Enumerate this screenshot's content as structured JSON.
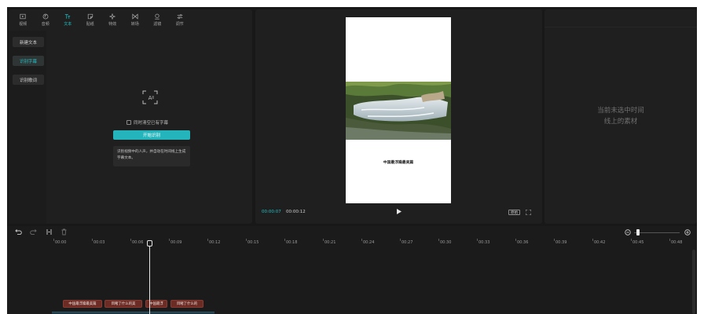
{
  "tabs": [
    {
      "label": "视频",
      "icon": "video-icon"
    },
    {
      "label": "音频",
      "icon": "audio-icon"
    },
    {
      "label": "文本",
      "icon": "text-icon",
      "active": true
    },
    {
      "label": "贴纸",
      "icon": "sticker-icon"
    },
    {
      "label": "特效",
      "icon": "effects-icon"
    },
    {
      "label": "转场",
      "icon": "transition-icon"
    },
    {
      "label": "滤镜",
      "icon": "filter-icon"
    },
    {
      "label": "调节",
      "icon": "adjust-icon"
    }
  ],
  "sidebar": {
    "items": [
      {
        "label": "新建文本"
      },
      {
        "label": "识别字幕",
        "active": true
      },
      {
        "label": "识别歌词"
      }
    ]
  },
  "caption_panel": {
    "checkbox_label": "同时清空已有字幕",
    "start_button": "开始识别",
    "tip": "识别视频中的人声，并自动在时间线上生成字幕文本。"
  },
  "player": {
    "subtitle": "中国最浮躁最美篇",
    "current_time": "00:00:07",
    "total_time": "00:00:12",
    "ratio_label": "原始"
  },
  "inspector": {
    "empty_line1": "当前未选中时间",
    "empty_line2": "线上的素材"
  },
  "timeline": {
    "ticks": [
      "00:00",
      "00:03",
      "00:06",
      "00:09",
      "00:12",
      "00:15",
      "00:18",
      "00:21",
      "00:24",
      "00:27",
      "00:30",
      "00:33",
      "00:36",
      "00:39",
      "00:42",
      "00:45",
      "00:48"
    ],
    "clips": [
      {
        "label": "中国最浮躁最美篇"
      },
      {
        "label": "目睹了什么的美"
      },
      {
        "label": "中国最浮"
      },
      {
        "label": "目睹了什么的"
      }
    ]
  },
  "colors": {
    "accent": "#23c2c8",
    "background": "#181818",
    "panel": "#1f1f1f",
    "clip": "#6b2c25"
  }
}
